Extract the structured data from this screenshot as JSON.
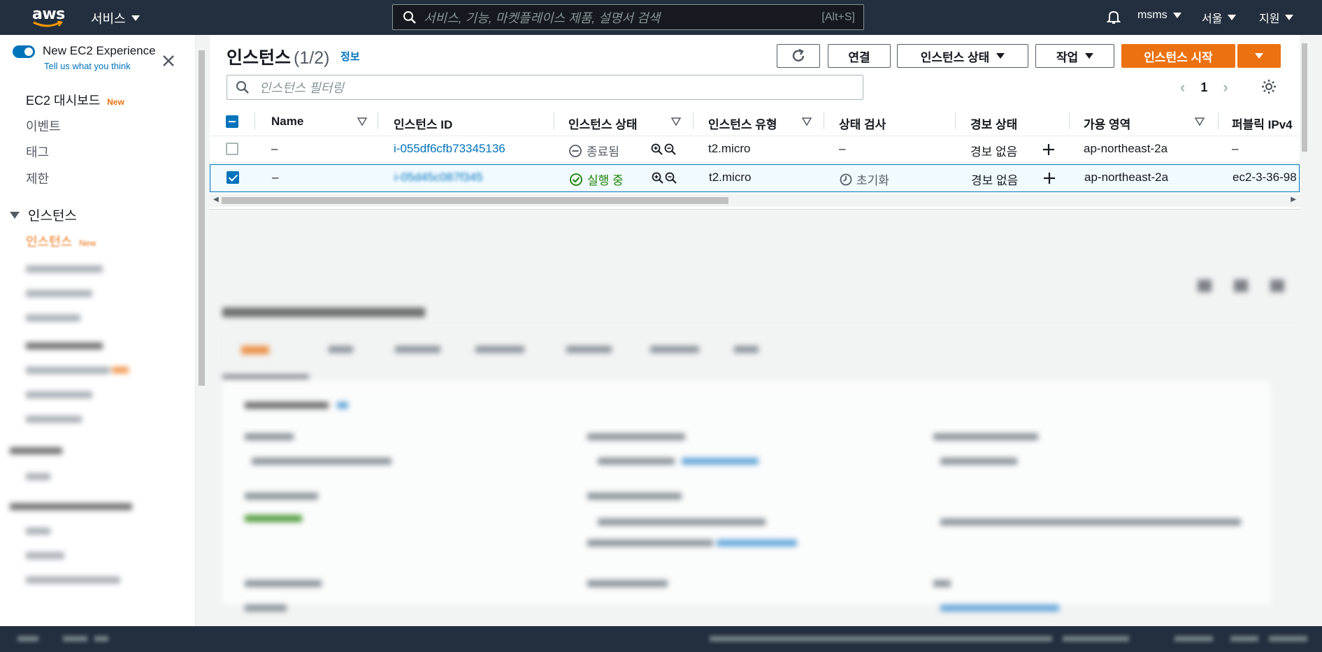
{
  "topnav": {
    "logo_text": "aws",
    "services_label": "서비스",
    "search_placeholder": "서비스, 기능, 마켓플레이스 제품, 설명서 검색",
    "search_shortcut": "[Alt+S]",
    "account_label": "msms",
    "region_label": "서울",
    "support_label": "지원"
  },
  "sidenav": {
    "experience_title": "New EC2 Experience",
    "experience_link": "Tell us what you think",
    "items": [
      {
        "label": "EC2 대시보드",
        "badge": "New"
      },
      {
        "label": "이벤트"
      },
      {
        "label": "태그"
      },
      {
        "label": "제한"
      }
    ],
    "section_label": "인스턴스",
    "active_item": {
      "label": "인스턴스",
      "badge": "New"
    }
  },
  "panel": {
    "title": "인스턴스",
    "count": "(1/2)",
    "info_link": "정보",
    "buttons": {
      "connect": "연결",
      "instance_state": "인스턴스 상태",
      "actions": "작업",
      "launch": "인스턴스 시작"
    },
    "filter_placeholder": "인스턴스 필터링",
    "page_number": "1"
  },
  "table": {
    "columns": [
      "Name",
      "인스턴스 ID",
      "인스턴스 상태",
      "인스턴스 유형",
      "상태 검사",
      "경보 상태",
      "가용 영역",
      "퍼블릭 IPv4"
    ],
    "rows": [
      {
        "name": "–",
        "instance_id": "i-055df6cfb73345136",
        "state": "종료됨",
        "type": "t2.micro",
        "status_check": "–",
        "alarm": "경보 없음",
        "az": "ap-northeast-2a",
        "public_ipv4": "–",
        "selected": false
      },
      {
        "name": "–",
        "instance_id": "i-05d45c087f345",
        "state": "실행 중",
        "type": "t2.micro",
        "status_check": "초기화",
        "alarm": "경보 없음",
        "az": "ap-northeast-2a",
        "public_ipv4": "ec2-3-36-98",
        "selected": true
      }
    ]
  },
  "colors": {
    "nav_bg": "#232f3e",
    "accent_orange": "#ec7211",
    "link_blue": "#0073bb",
    "running_green": "#1d8102"
  }
}
